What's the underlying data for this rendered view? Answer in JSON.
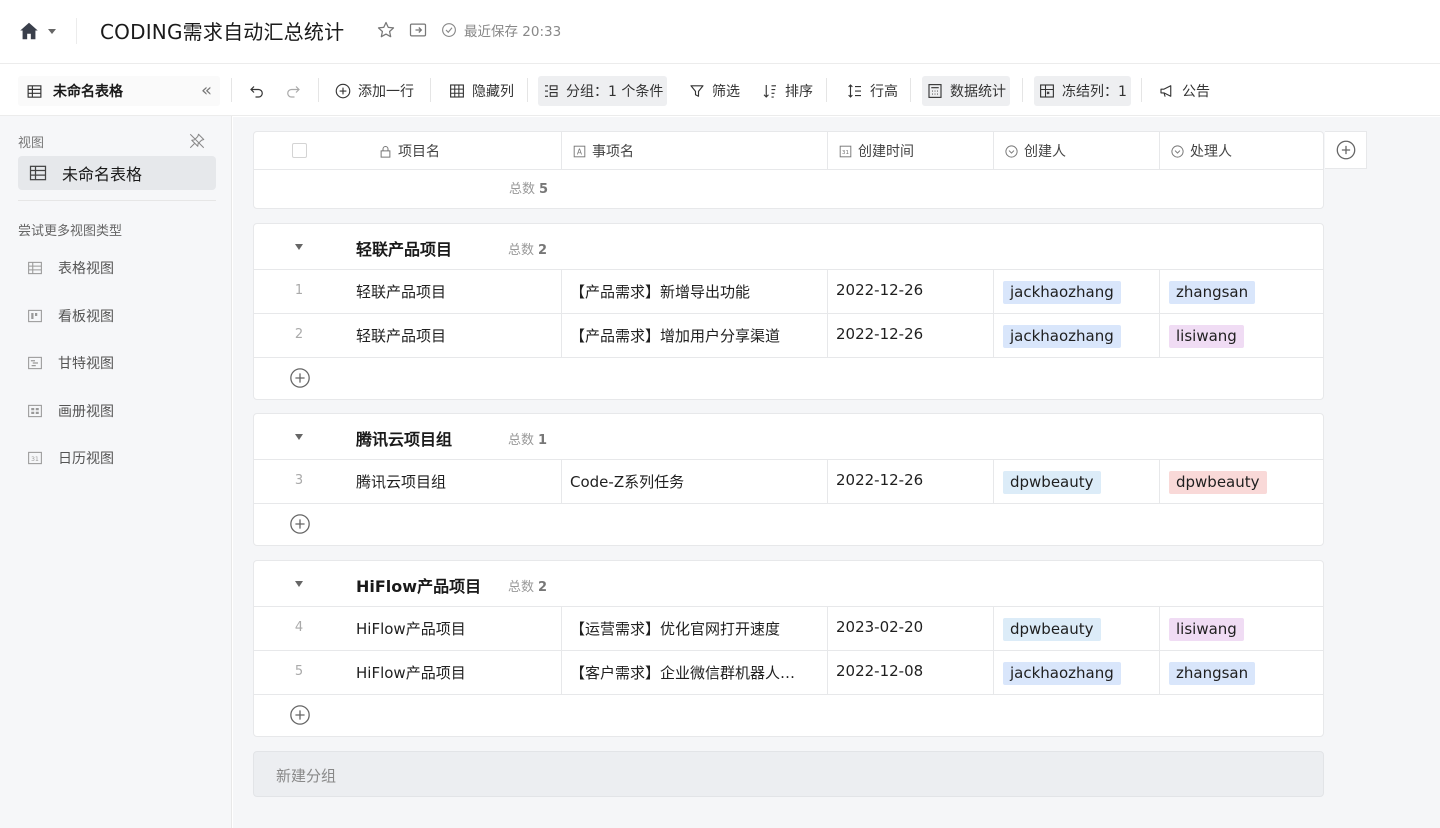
{
  "app": {
    "doc_title": "CODING需求自动汇总统计",
    "saved_text": "最近保存 20:33"
  },
  "toolbar": {
    "view_name": "未命名表格",
    "collapse_glyph": "«",
    "add_row": "添加一行",
    "hide_cols": "隐藏列",
    "group": "分组：1 个条件",
    "filter": "筛选",
    "sort": "排序",
    "row_height": "行高",
    "data_stats": "数据统计",
    "freeze": "冻结列：1",
    "announcement": "公告"
  },
  "sidebar": {
    "views_heading": "视图",
    "active_view": "未命名表格",
    "try_more": "尝试更多视图类型",
    "view_types": [
      {
        "label": "表格视图",
        "icon": "table-icon"
      },
      {
        "label": "看板视图",
        "icon": "kanban-icon"
      },
      {
        "label": "甘特视图",
        "icon": "gantt-icon"
      },
      {
        "label": "画册视图",
        "icon": "gallery-icon"
      },
      {
        "label": "日历视图",
        "icon": "calendar-icon"
      }
    ]
  },
  "table": {
    "columns": [
      "项目名",
      "事项名",
      "创建时间",
      "创建人",
      "处理人"
    ],
    "total_label": "总数",
    "total_value": "5",
    "groups": [
      {
        "name": "轻联产品项目",
        "count": "2",
        "rows": [
          {
            "num": "1",
            "project": "轻联产品项目",
            "item": "【产品需求】新增导出功能",
            "created": "2022-12-26",
            "creator": "jackhaozhang",
            "handler": "zhangsan"
          },
          {
            "num": "2",
            "project": "轻联产品项目",
            "item": "【产品需求】增加用户分享渠道",
            "created": "2022-12-26",
            "creator": "jackhaozhang",
            "handler": "lisiwang"
          }
        ]
      },
      {
        "name": "腾讯云项目组",
        "count": "1",
        "rows": [
          {
            "num": "3",
            "project": "腾讯云项目组",
            "item": "Code-Z系列任务",
            "created": "2022-12-26",
            "creator": "dpwbeauty",
            "handler": "dpwbeauty"
          }
        ]
      },
      {
        "name": "HiFlow产品项目",
        "count": "2",
        "rows": [
          {
            "num": "4",
            "project": "HiFlow产品项目",
            "item": "【运营需求】优化官网打开速度",
            "created": "2023-02-20",
            "creator": "dpwbeauty",
            "handler": "lisiwang"
          },
          {
            "num": "5",
            "project": "HiFlow产品项目",
            "item": "【客户需求】企业微信群机器人…",
            "created": "2022-12-08",
            "creator": "jackhaozhang",
            "handler": "zhangsan"
          }
        ]
      }
    ],
    "new_group": "新建分组"
  },
  "colors": {
    "tag_blue": "#d9e6fb",
    "tag_cyan": "#dcecf8",
    "tag_pink": "#f0dcf4",
    "tag_red": "#f9d9d8",
    "sidebar_bg": "#f6f7f9",
    "canvas_bg": "#f5f6f8"
  }
}
